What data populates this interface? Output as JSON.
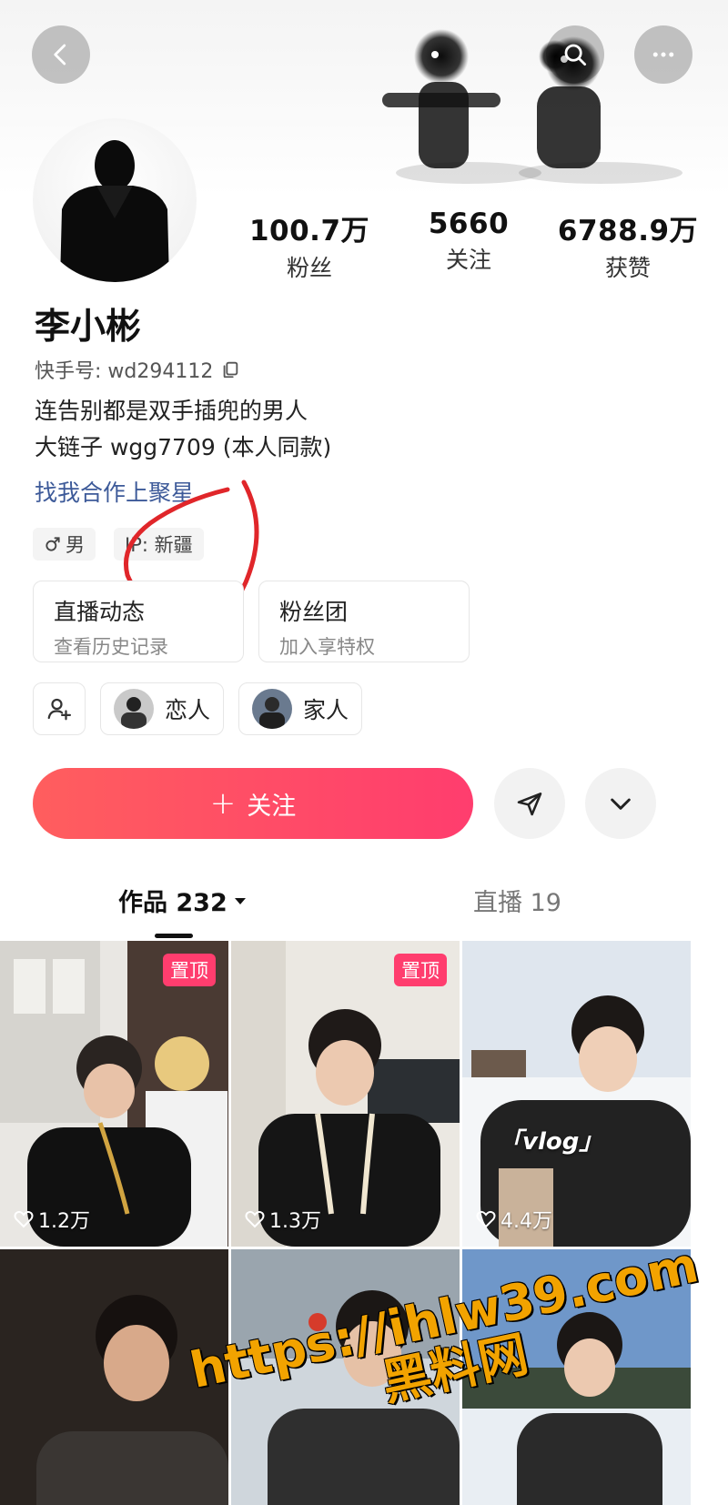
{
  "header": {
    "back_icon": "chevron-left-icon",
    "search_icon": "search-icon",
    "more_icon": "more-dots-icon"
  },
  "stats": [
    {
      "value": "100.7万",
      "label": "粉丝"
    },
    {
      "value": "5660",
      "label": "关注"
    },
    {
      "value": "6788.9万",
      "label": "获赞"
    }
  ],
  "profile": {
    "name": "李小彬",
    "id_text": "快手号: wd294112",
    "bio_line1": "连告别都是双手插兜的男人",
    "bio_line2": "大链子 wgg7709 (本人同款)",
    "link": "找我合作上聚星",
    "gender_tag": "男",
    "ip_tag": "IP: 新疆"
  },
  "cards": [
    {
      "title": "直播动态",
      "subtitle": "查看历史记录"
    },
    {
      "title": "粉丝团",
      "subtitle": "加入享特权"
    }
  ],
  "relations": [
    {
      "label": "恋人"
    },
    {
      "label": "家人"
    }
  ],
  "follow": {
    "label": "关注"
  },
  "tabs": {
    "works": "作品 232",
    "live": "直播 19"
  },
  "grid": [
    {
      "pin": "置顶",
      "likes": "1.2万"
    },
    {
      "pin": "置顶",
      "likes": "1.3万"
    },
    {
      "tag": "「vlog」",
      "likes": "4.4万"
    },
    {},
    {},
    {}
  ],
  "watermark": {
    "line1": "https://ihlw39.com",
    "line2": "黑料网"
  },
  "colors": {
    "follow_gradient_start": "#ff5e5e",
    "follow_gradient_end": "#ff3d6e",
    "link": "#3d5a99",
    "pin": "#ff3d6e",
    "annotation": "#e0262a"
  }
}
